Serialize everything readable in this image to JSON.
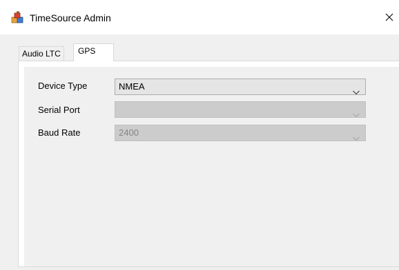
{
  "window": {
    "title": "TimeSource Admin",
    "app_icon": "app-blocks-icon",
    "close_icon": "close-icon"
  },
  "tabs": [
    {
      "label": "Audio LTC",
      "selected": false
    },
    {
      "label": "GPS",
      "selected": true
    }
  ],
  "gps": {
    "device_type": {
      "label": "Device Type",
      "value": "NMEA",
      "enabled": true
    },
    "serial_port": {
      "label": "Serial Port",
      "value": "",
      "enabled": false
    },
    "baud_rate": {
      "label": "Baud Rate",
      "value": "2400",
      "enabled": false
    }
  },
  "colors": {
    "client_bg": "#f0f0f0",
    "disabled_combo_bg": "#cccccc",
    "disabled_text": "#838383",
    "enabled_combo_bg": "#e5e5e5"
  }
}
